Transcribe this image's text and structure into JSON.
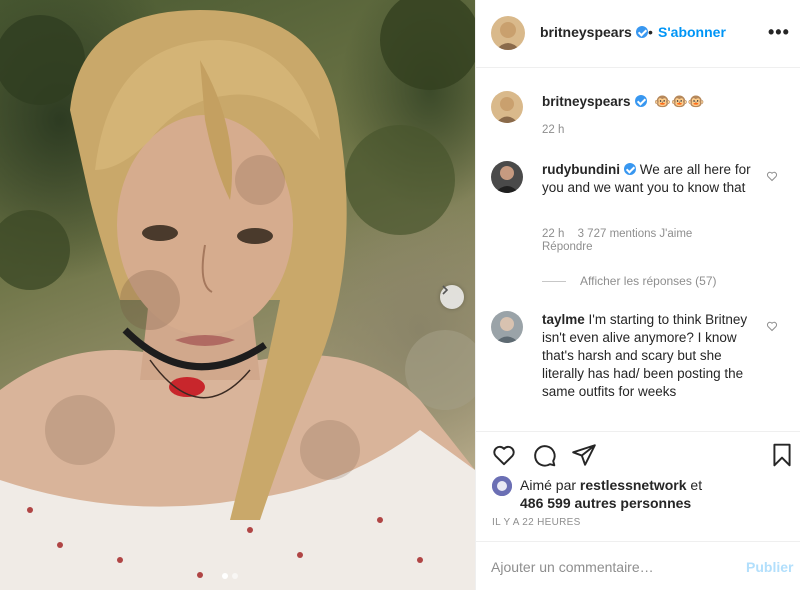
{
  "post": {
    "username": "britneyspears",
    "follow_separator": "•",
    "follow_label": "S'abonner",
    "more_label": "•••",
    "caption_emoji": "🐵🐵🐵",
    "caption_time": "22 h",
    "carousel": {
      "slides": 2,
      "active_index": 0
    }
  },
  "comments": [
    {
      "username": "rudybundini",
      "verified": true,
      "text": "We are all here for you and we want you to know that",
      "time": "22 h",
      "likes": "3 727 mentions J'aime",
      "reply_label": "Répondre",
      "view_replies": "Afficher les réponses (57)"
    },
    {
      "username": "taylme",
      "verified": false,
      "text": "I'm starting to think Britney isn't even alive anymore? I know that's harsh and scary but she literally has had/ been posting the same outfits for weeks"
    }
  ],
  "likes": {
    "prefix": "Aimé par ",
    "user": "restlessnetwork",
    "suffix": " et",
    "others": "486 599 autres personnes"
  },
  "timestamp": "IL Y A 22 HEURES",
  "add_comment": {
    "placeholder": "Ajouter un commentaire…",
    "publish_label": "Publier"
  },
  "colors": {
    "accent": "#0095f6",
    "publish_disabled": "#b2dffc",
    "meta_gray": "#8e8e8e",
    "text": "#262626"
  },
  "icons": [
    "more-options-icon",
    "heart-icon",
    "comment-icon",
    "share-icon",
    "bookmark-icon",
    "verified-badge-icon",
    "chevron-right-icon"
  ]
}
